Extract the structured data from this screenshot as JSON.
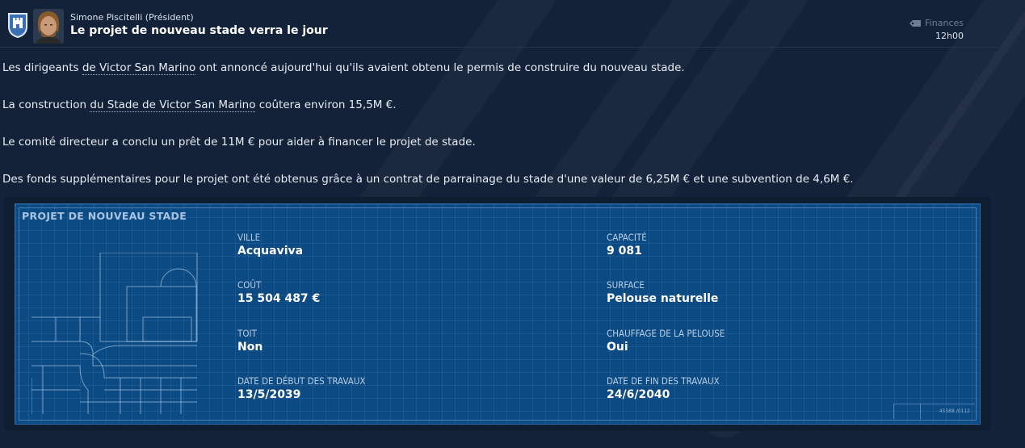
{
  "header": {
    "sender": "Simone Piscitelli  (Président)",
    "subject": "Le projet de nouveau stade verra le jour",
    "category": "Finances",
    "time": "12h00"
  },
  "body": {
    "p1_before": "Les dirigeants ",
    "p1_link": "de Victor San Marino",
    "p1_after": " ont annoncé aujourd'hui qu'ils avaient obtenu le permis de construire du nouveau stade.",
    "p2_before": "La construction ",
    "p2_link": "du Stade de Victor San Marino",
    "p2_after": " coûtera environ 15,5M €.",
    "p3": "Le comité directeur a conclu un prêt de 11M € pour aider à financer le projet de stade.",
    "p4": "Des fonds supplémentaires pour le projet ont été obtenus grâce à un contrat de parrainage du stade d'une valeur de 6,25M € et une subvention de 4,6M €."
  },
  "card": {
    "title": "PROJET DE NOUVEAU STADE",
    "ref": "45588 /0112",
    "fields": {
      "ville_label": "VILLE",
      "ville_value": "Acquaviva",
      "capacite_label": "CAPACITÉ",
      "capacite_value": "9 081",
      "cout_label": "COÛT",
      "cout_value": "15 504 487 €",
      "surface_label": "SURFACE",
      "surface_value": "Pelouse naturelle",
      "toit_label": "TOIT",
      "toit_value": "Non",
      "chauffage_label": "CHAUFFAGE DE LA PELOUSE",
      "chauffage_value": "Oui",
      "debut_label": "DATE DE DÉBUT DES TRAVAUX",
      "debut_value": "13/5/2039",
      "fin_label": "DATE DE FIN DES TRAVAUX",
      "fin_value": "24/6/2040"
    }
  },
  "icons": {
    "badge": "club-crest-icon",
    "category": "finances-tag-icon"
  },
  "colors": {
    "background": "#132238",
    "card": "#0c4a84"
  }
}
